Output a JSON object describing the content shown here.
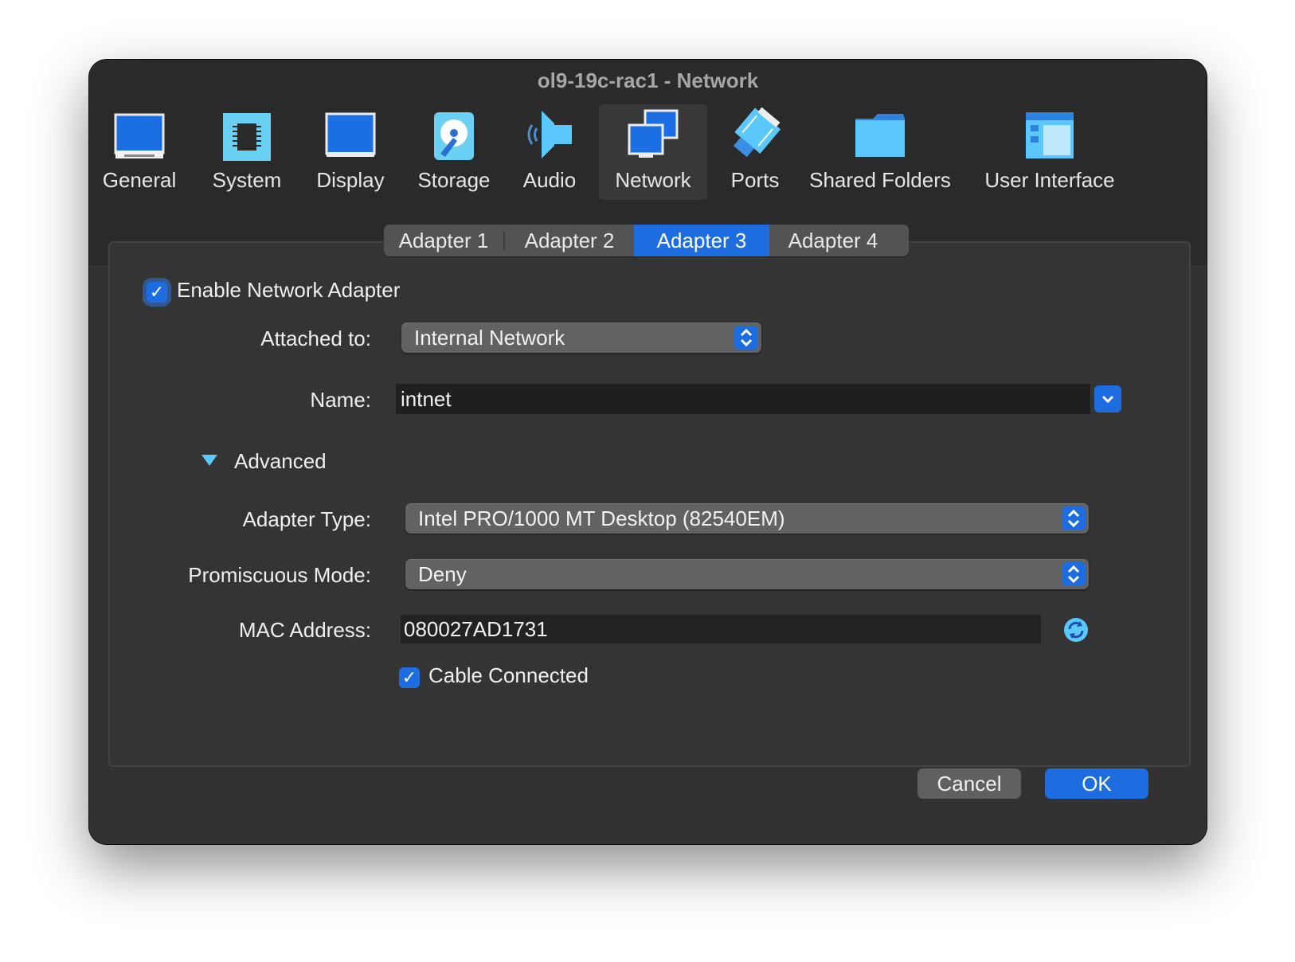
{
  "window": {
    "title": "ol9-19c-rac1 - Network"
  },
  "toolbar": {
    "items": [
      {
        "label": "General",
        "icon": "general-icon"
      },
      {
        "label": "System",
        "icon": "system-chip-icon"
      },
      {
        "label": "Display",
        "icon": "display-monitor-icon"
      },
      {
        "label": "Storage",
        "icon": "storage-disk-icon"
      },
      {
        "label": "Audio",
        "icon": "audio-speaker-icon"
      },
      {
        "label": "Network",
        "icon": "network-icon",
        "selected": true
      },
      {
        "label": "Ports",
        "icon": "ports-plug-icon"
      },
      {
        "label": "Shared Folders",
        "icon": "shared-folder-icon"
      },
      {
        "label": "User Interface",
        "icon": "user-interface-icon"
      }
    ]
  },
  "tabs": [
    {
      "label": "Adapter 1"
    },
    {
      "label": "Adapter 2"
    },
    {
      "label": "Adapter 3",
      "selected": true
    },
    {
      "label": "Adapter 4"
    }
  ],
  "form": {
    "enable_adapter": {
      "label": "Enable Network Adapter",
      "checked": true
    },
    "attached_to": {
      "label": "Attached to:",
      "value": "Internal Network"
    },
    "name": {
      "label": "Name:",
      "value": "intnet"
    },
    "advanced": {
      "label": "Advanced",
      "expanded": true
    },
    "adapter_type": {
      "label": "Adapter Type:",
      "value": "Intel PRO/1000 MT Desktop (82540EM)"
    },
    "promiscuous_mode": {
      "label": "Promiscuous Mode:",
      "value": "Deny"
    },
    "mac_address": {
      "label": "MAC Address:",
      "value": "080027AD1731"
    },
    "cable_connected": {
      "label": "Cable Connected",
      "checked": true
    }
  },
  "buttons": {
    "cancel": "Cancel",
    "ok": "OK"
  },
  "colors": {
    "accent": "#1d6de0",
    "window_bg": "#323232",
    "titlebar_bg": "#2a2a2a",
    "icon_blue": "#5ac8fa"
  }
}
